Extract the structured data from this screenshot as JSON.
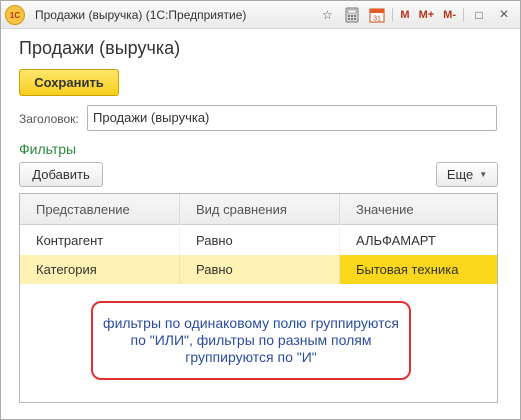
{
  "window": {
    "title": "Продажи (выручка)  (1С:Предприятие)",
    "logo_text": "1С"
  },
  "titlebar_icons": {
    "bookmark": "☆",
    "calendar_label": "31",
    "m_label": "M",
    "m_plus_label": "M+",
    "m_minus_label": "M-",
    "restore": "□",
    "close": "×"
  },
  "form": {
    "title": "Продажи (выручка)",
    "save_label": "Сохранить",
    "header_label": "Заголовок:",
    "header_value": "Продажи (выручка)"
  },
  "filters": {
    "title": "Фильтры",
    "add_label": "Добавить",
    "more_label": "Еще",
    "columns": [
      "Представление",
      "Вид сравнения",
      "Значение"
    ],
    "rows": [
      [
        "Контрагент",
        "Равно",
        "АЛЬФАМАРТ"
      ],
      [
        "Категория",
        "Равно",
        "Бытовая техника"
      ]
    ]
  },
  "callout": {
    "text": "фильтры по одинаковому полю группируются по \"ИЛИ\", фильтры по разным полям группируются по \"И\""
  },
  "colors": {
    "accent_yellow": "#f7cf1f",
    "selected_row": "#fdf2b4",
    "selected_cell": "#f9d71c",
    "filters_heading": "#2a8a3c",
    "callout_border": "#e03131",
    "callout_text": "#2b4c9e"
  }
}
